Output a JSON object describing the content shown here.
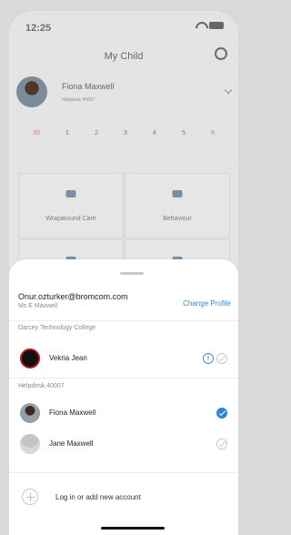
{
  "status": {
    "time": "12:25"
  },
  "header": {
    "title": "My Child"
  },
  "child": {
    "name": "Fiona Maxwell",
    "subtitle": "Helpdesk 40007"
  },
  "days": [
    "30",
    "1",
    "2",
    "3",
    "4",
    "5",
    "6"
  ],
  "tiles": [
    {
      "label": "Wraparound Care",
      "icon": "care-icon"
    },
    {
      "label": "Behaviour",
      "icon": "behaviour-icon"
    }
  ],
  "sheet": {
    "account": {
      "email": "Onur.ozturker@bromcom.com",
      "teacher": "Ms E Maxwell",
      "change_label": "Change Profile"
    },
    "sections": [
      {
        "title": "Darcey Technology College",
        "people": [
          {
            "name": "Vekria Jean",
            "selected": false,
            "info": true
          }
        ]
      },
      {
        "title": "Helpdesk 40007",
        "people": [
          {
            "name": "Fiona Maxwell",
            "selected": true
          },
          {
            "name": "Jane Maxwell",
            "selected": false
          }
        ]
      }
    ],
    "add_account": "Log in or add new account"
  }
}
